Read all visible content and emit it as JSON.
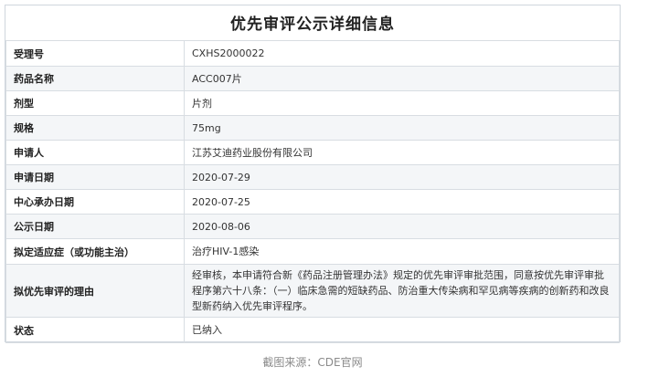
{
  "page_title": "优先审评公示详细信息",
  "rows": [
    {
      "label": "受理号",
      "value": "CXHS2000022"
    },
    {
      "label": "药品名称",
      "value": "ACC007片"
    },
    {
      "label": "剂型",
      "value": "片剂"
    },
    {
      "label": "规格",
      "value": "75mg"
    },
    {
      "label": "申请人",
      "value": "江苏艾迪药业股份有限公司"
    },
    {
      "label": "申请日期",
      "value": "2020-07-29"
    },
    {
      "label": "中心承办日期",
      "value": "2020-07-25"
    },
    {
      "label": "公示日期",
      "value": "2020-08-06"
    },
    {
      "label": "拟定适应症（或功能主治）",
      "value": "治疗HIV-1感染"
    },
    {
      "label": "拟优先审评的理由",
      "value": "经审核，本申请符合新《药品注册管理办法》规定的优先审评审批范围，同意按优先审评审批程序第六十八条：（一）临床急需的短缺药品、防治重大传染病和罕见病等疾病的创新药和改良型新药纳入优先审评程序。"
    },
    {
      "label": "状态",
      "value": "已纳入"
    }
  ],
  "caption": "截图来源：CDE官网"
}
